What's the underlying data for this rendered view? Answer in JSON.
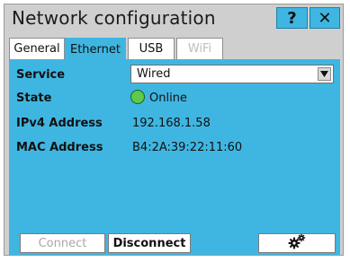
{
  "window": {
    "title": "Network configuration",
    "help_label": "?",
    "close_label": "✕"
  },
  "tabs": [
    {
      "label": "General"
    },
    {
      "label": "Ethernet"
    },
    {
      "label": "USB"
    },
    {
      "label": "WiFi"
    }
  ],
  "form": {
    "service_label": "Service",
    "service_value": "Wired",
    "state_label": "State",
    "state_value": "Online",
    "ipv4_label": "IPv4 Address",
    "ipv4_value": "192.168.1.58",
    "mac_label": "MAC Address",
    "mac_value": "B4:2A:39:22:11:60"
  },
  "actions": {
    "connect_label": "Connect",
    "disconnect_label": "Disconnect"
  },
  "icons": {
    "settings": "gears-icon",
    "dropdown": "triangle-down-icon",
    "status": "online-status-icon"
  },
  "colors": {
    "accent": "#3fb6e2",
    "online": "#5ec94a",
    "window_bg": "#cfcfcf"
  }
}
